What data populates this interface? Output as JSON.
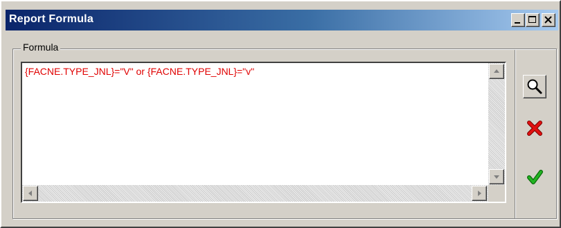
{
  "window": {
    "title": "Report Formula"
  },
  "group": {
    "label": "Formula"
  },
  "editor": {
    "formula": "{FACNE.TYPE_JNL}=\"V\" or {FACNE.TYPE_JNL}=\"v\"",
    "text_color": "#e00000"
  },
  "toolbar": {
    "buttons": [
      {
        "icon": "magnifier-icon"
      },
      {
        "icon": "red-x-icon"
      },
      {
        "icon": "green-check-icon"
      }
    ]
  },
  "colors": {
    "title_start": "#0a246a",
    "title_end": "#a6caf0",
    "face": "#d4d0c8"
  }
}
